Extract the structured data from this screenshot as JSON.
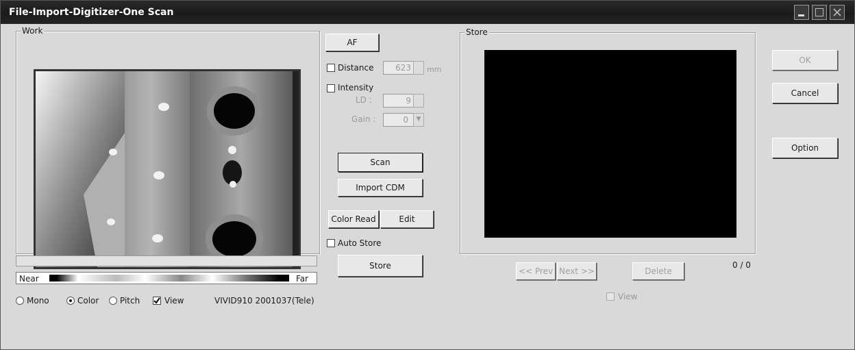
{
  "window": {
    "title": "File-Import-Digitizer-One Scan"
  },
  "work": {
    "label": "Work",
    "legend": {
      "near": "Near",
      "far": "Far"
    },
    "display_mode": {
      "options": [
        "Mono",
        "Color",
        "Pitch"
      ],
      "selected": "Color"
    },
    "view_label": "View",
    "view_checked": true,
    "device_info": "VIVID910  2001037(Tele)"
  },
  "controls": {
    "af_label": "AF",
    "distance_label": "Distance",
    "distance_value": "623",
    "distance_unit": "mm",
    "intensity_label": "Intensity",
    "ld_label": "LD :",
    "ld_value": "9",
    "gain_label": "Gain :",
    "gain_value": "0",
    "scan_label": "Scan",
    "import_cdm_label": "Import CDM",
    "color_read_label": "Color Read",
    "edit_label": "Edit",
    "auto_store_label": "Auto Store",
    "store_label": "Store"
  },
  "store": {
    "label": "Store",
    "prev_label": "<< Prev",
    "next_label": "Next >>",
    "delete_label": "Delete",
    "counter": "0 / 0",
    "view_label": "View"
  },
  "dialog_buttons": {
    "ok": "OK",
    "cancel": "Cancel",
    "option": "Option"
  }
}
